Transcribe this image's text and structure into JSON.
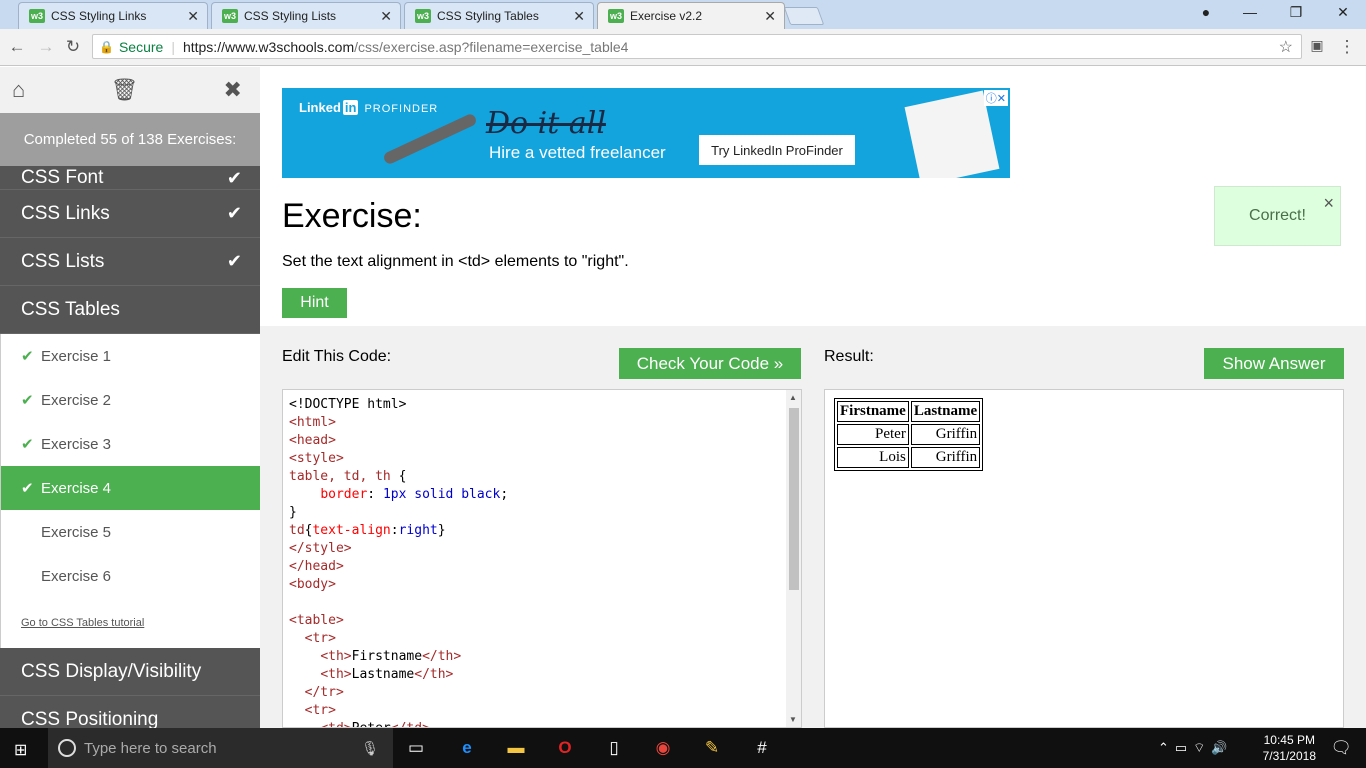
{
  "browser": {
    "tabs": [
      {
        "label": "CSS Styling Links",
        "favicon": "w3"
      },
      {
        "label": "CSS Styling Lists",
        "favicon": "w3"
      },
      {
        "label": "CSS Styling Tables",
        "favicon": "w3"
      },
      {
        "label": "Exercise v2.2",
        "favicon": "w3"
      }
    ],
    "secure_label": "Secure",
    "url_host": "https://www.w3schools.com",
    "url_path": "/css/exercise.asp?filename=exercise_table4"
  },
  "sidebar": {
    "completed_text": "Completed 55 of 138 Exercises:",
    "categories_before": [
      {
        "label": "CSS Font",
        "done": true
      },
      {
        "label": "CSS Links",
        "done": true
      },
      {
        "label": "CSS Lists",
        "done": true
      }
    ],
    "open_category": "CSS Tables",
    "exercises": [
      {
        "label": "Exercise 1",
        "done": true
      },
      {
        "label": "Exercise 2",
        "done": true
      },
      {
        "label": "Exercise 3",
        "done": true
      },
      {
        "label": "Exercise 4",
        "done": true,
        "active": true
      },
      {
        "label": "Exercise 5",
        "done": false
      },
      {
        "label": "Exercise 6",
        "done": false
      }
    ],
    "tutorial_link": "Go to CSS Tables tutorial",
    "categories_after": [
      {
        "label": "CSS Display/Visibility"
      },
      {
        "label": "CSS Positioning"
      }
    ]
  },
  "ad": {
    "brand": "Linked",
    "brand_in": "in",
    "brand_sub": "PROFINDER",
    "headline": "Do it all",
    "tagline": "Hire a vetted freelancer",
    "cta": "Try LinkedIn ProFinder"
  },
  "exercise": {
    "title": "Exercise:",
    "description": "Set the text alignment in <td> elements to \"right\".",
    "hint_label": "Hint",
    "correct_label": "Correct!"
  },
  "editor": {
    "label": "Edit This Code:",
    "check_label": "Check Your Code »"
  },
  "result": {
    "label": "Result:",
    "show_label": "Show Answer",
    "table": {
      "headers": [
        "Firstname",
        "Lastname"
      ],
      "rows": [
        [
          "Peter",
          "Griffin"
        ],
        [
          "Lois",
          "Griffin"
        ]
      ]
    }
  },
  "taskbar": {
    "search_placeholder": "Type here to search",
    "time": "10:45 PM",
    "date": "7/31/2018"
  },
  "colors": {
    "accent": "#4caf50",
    "sidebar_bg": "#555555",
    "ad_bg": "#13a3dd"
  }
}
